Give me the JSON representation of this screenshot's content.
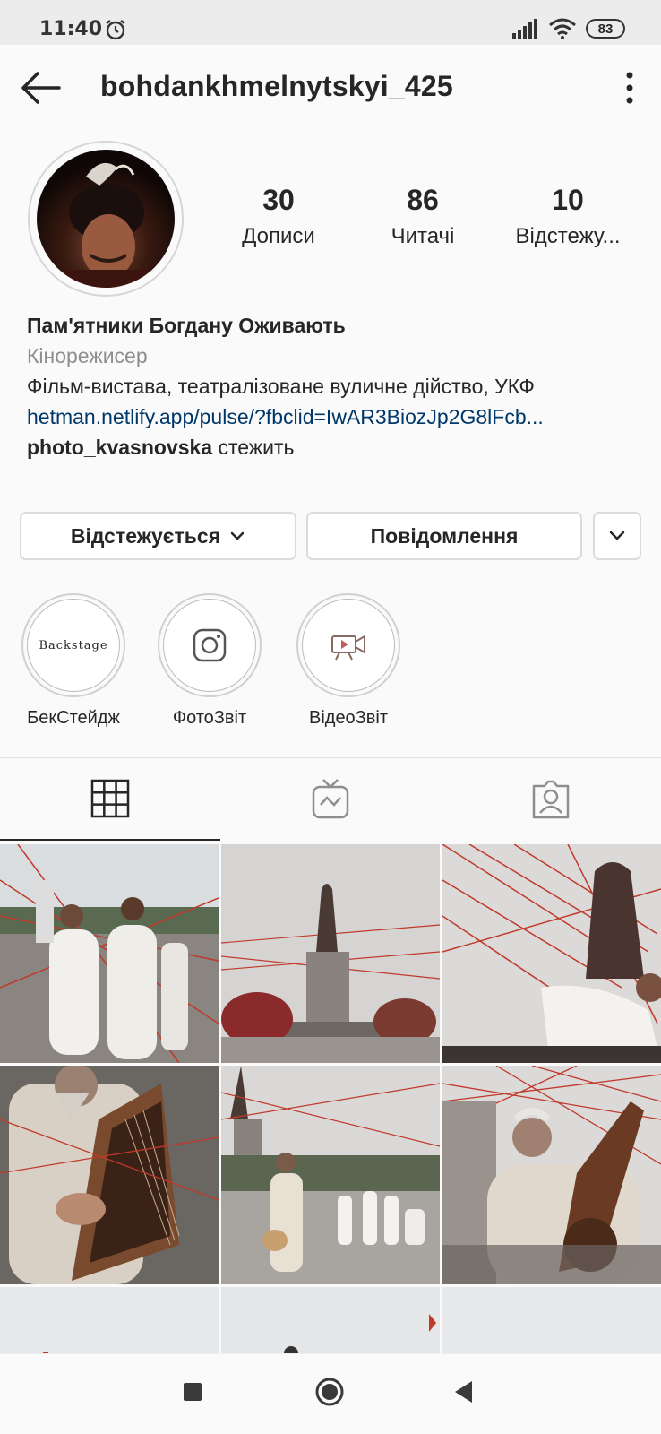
{
  "status_bar": {
    "time": "11:40",
    "battery": "83",
    "icons": [
      "alarm-icon",
      "signal-icon",
      "wifi-icon",
      "battery-icon"
    ]
  },
  "header": {
    "username": "bohdankhmelnytskyi_425",
    "icons": [
      "back-arrow-icon",
      "more-vertical-icon"
    ]
  },
  "stats": [
    {
      "value": "30",
      "label": "Дописи"
    },
    {
      "value": "86",
      "label": "Читачі"
    },
    {
      "value": "10",
      "label": "Відстежу..."
    }
  ],
  "bio": {
    "name": "Пам'ятники Богдану Оживають",
    "category": "Кінорежисер",
    "description": "Фільм-вистава, театралізоване вуличне дійство, УКФ",
    "link": "hetman.netlify.app/pulse/?fbclid=IwAR3BiozJp2G8lFcb...",
    "followed_by_user": "photo_kvasnovska",
    "followed_by_suffix": " стежить"
  },
  "actions": {
    "following_label": "Відстежується",
    "message_label": "Повідомлення"
  },
  "highlights": [
    {
      "label": "БекСтейдж",
      "cover_text": "Backstage"
    },
    {
      "label": "ФотоЗвіт",
      "icon": "instagram-icon"
    },
    {
      "label": "ВідеоЗвіт",
      "icon": "video-camera-icon"
    }
  ],
  "tabs": [
    {
      "name": "grid",
      "icon": "grid-icon",
      "active": true
    },
    {
      "name": "igtv",
      "icon": "igtv-icon",
      "active": false
    },
    {
      "name": "tagged",
      "icon": "tagged-icon",
      "active": false
    }
  ],
  "colors": {
    "accent_link": "#00376b",
    "text": "#262626",
    "muted": "#8e8e8e",
    "thread_red": "#c0392b"
  },
  "nav": {
    "icons": [
      "recent-apps-icon",
      "home-icon",
      "back-icon"
    ]
  }
}
